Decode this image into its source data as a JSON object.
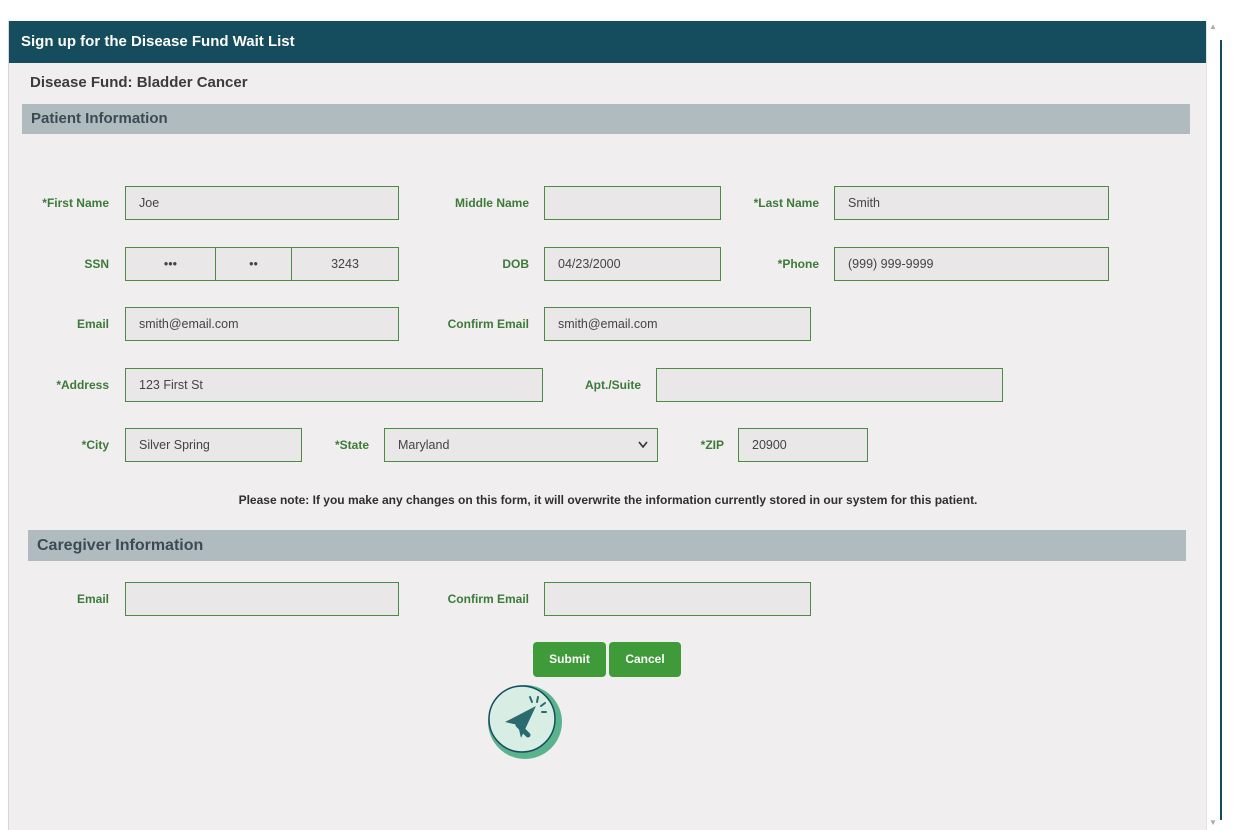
{
  "dialog": {
    "title": "Sign up for the Disease Fund Wait List",
    "fund_label": "Disease Fund: Bladder Cancer"
  },
  "patient": {
    "section_title": "Patient Information",
    "labels": {
      "first_name": "*First Name",
      "middle_name": "Middle Name",
      "last_name": "*Last Name",
      "ssn": "SSN",
      "dob": "DOB",
      "phone": "*Phone",
      "email": "Email",
      "confirm_email": "Confirm Email",
      "address": "*Address",
      "apt": "Apt./Suite",
      "city": "*City",
      "state": "*State",
      "zip": "*ZIP"
    },
    "values": {
      "first_name": "Joe",
      "middle_name": "",
      "last_name": "Smith",
      "ssn_part1": "•••",
      "ssn_part2": "••",
      "ssn_part3": "3243",
      "dob": "04/23/2000",
      "phone": "(999) 999-9999",
      "email": "smith@email.com",
      "confirm_email": "smith@email.com",
      "address": "123 First St",
      "apt": "",
      "city": "Silver Spring",
      "state": "Maryland",
      "zip": "20900"
    },
    "note": "Please note: If you make any changes on this form, it will overwrite the information currently stored in our system for this patient."
  },
  "caregiver": {
    "section_title": "Caregiver Information",
    "labels": {
      "email": "Email",
      "confirm_email": "Confirm Email"
    },
    "values": {
      "email": "",
      "confirm_email": ""
    }
  },
  "buttons": {
    "submit": "Submit",
    "cancel": "Cancel"
  },
  "icons": {
    "dropdown": "chevron-down-icon",
    "cursor": "cursor-click-icon"
  },
  "colors": {
    "header": "#154d5e",
    "section": "#b0bbbf",
    "accent_green": "#3f9b3a",
    "label_green": "#3d7a3a"
  }
}
